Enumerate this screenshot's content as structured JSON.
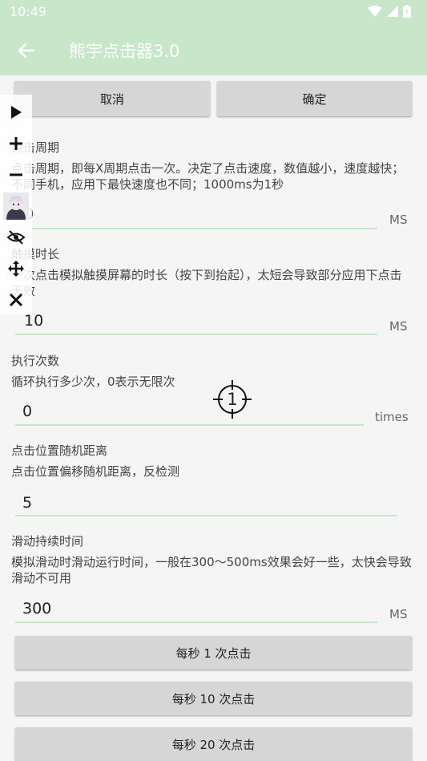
{
  "status_bar": {
    "time": "10:49"
  },
  "app_bar": {
    "title": "熊宇点击器3.0"
  },
  "dialog": {
    "cancel_label": "取消",
    "confirm_label": "确定"
  },
  "fields": [
    {
      "title": "点击周期",
      "description": "点击周期，即每X周期点击一次。决定了点击速度，数值越小，速度越快；不同手机，应用下最快速度也不同；1000ms为1秒",
      "value": "0",
      "unit": "MS"
    },
    {
      "title": "触摸时长",
      "description": "一次点击模拟触摸屏幕的时长（按下到抬起），太短会导致部分应用下点击无效",
      "value": "10",
      "unit": "MS"
    },
    {
      "title": "执行次数",
      "description": "循环执行多少次，0表示无限次",
      "value": "0",
      "unit": "times"
    },
    {
      "title": "点击位置随机距离",
      "description": "点击位置偏移随机距离，反检测",
      "value": "5",
      "unit": ""
    },
    {
      "title": "滑动持续时间",
      "description": "模拟滑动时滑动运行时间，一般在300～500ms效果会好一些，太快会导致滑动不可用",
      "value": "300",
      "unit": "MS"
    }
  ],
  "preset_buttons": [
    "每秒 1 次点击",
    "每秒 10 次点击",
    "每秒 20 次点击"
  ],
  "target": {
    "number": "1"
  },
  "colors": {
    "accent": "#c8e6c9",
    "button": "#d6d6d6"
  }
}
